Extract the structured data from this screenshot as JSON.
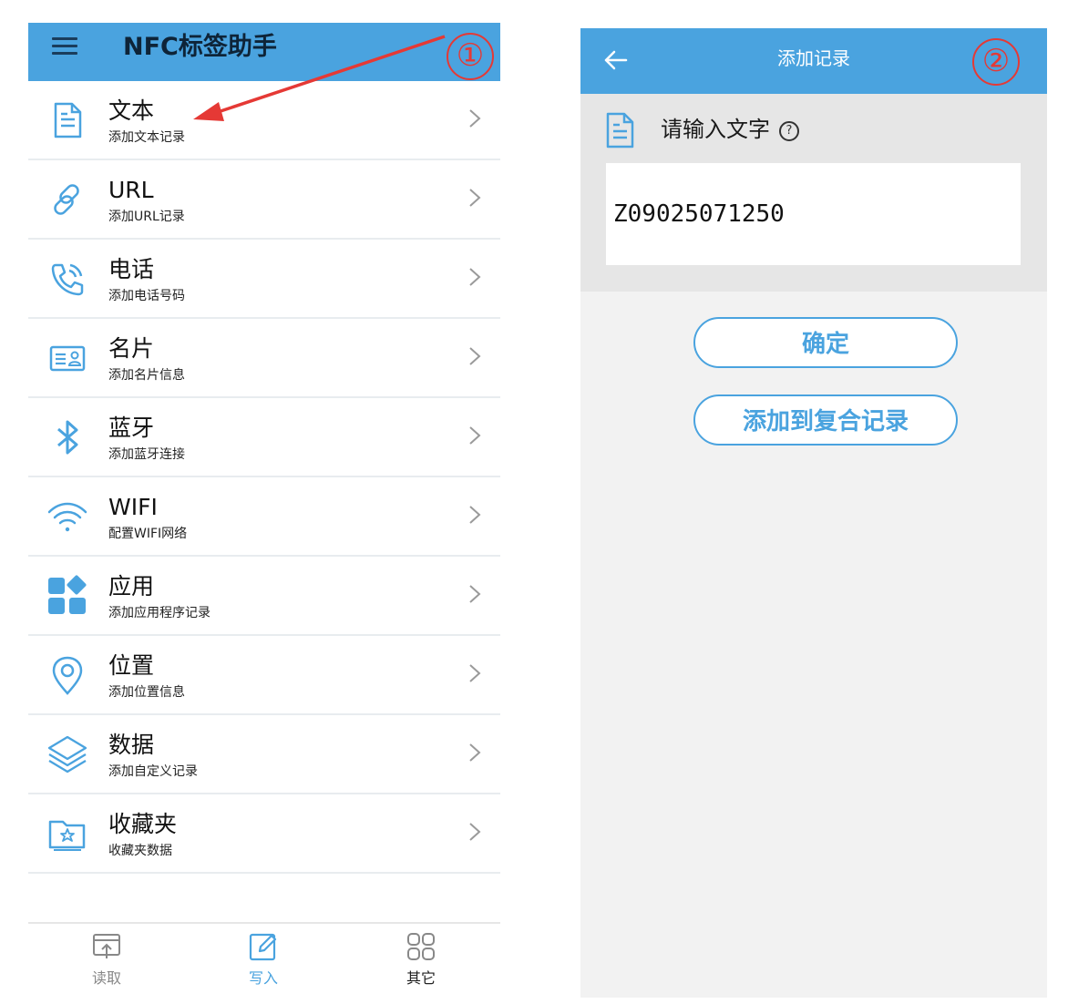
{
  "left": {
    "app_title": "NFC标签助手",
    "items": [
      {
        "title": "文本",
        "subtitle": "添加文本记录",
        "icon": "document-icon"
      },
      {
        "title": "URL",
        "subtitle": "添加URL记录",
        "icon": "link-icon"
      },
      {
        "title": "电话",
        "subtitle": "添加电话号码",
        "icon": "phone-icon"
      },
      {
        "title": "名片",
        "subtitle": "添加名片信息",
        "icon": "contact-card-icon"
      },
      {
        "title": "蓝牙",
        "subtitle": "添加蓝牙连接",
        "icon": "bluetooth-icon"
      },
      {
        "title": "WIFI",
        "subtitle": "配置WIFI网络",
        "icon": "wifi-icon"
      },
      {
        "title": "应用",
        "subtitle": "添加应用程序记录",
        "icon": "apps-icon"
      },
      {
        "title": "位置",
        "subtitle": "添加位置信息",
        "icon": "location-pin-icon"
      },
      {
        "title": "数据",
        "subtitle": "添加自定义记录",
        "icon": "layers-icon"
      },
      {
        "title": "收藏夹",
        "subtitle": "收藏夹数据",
        "icon": "favorites-folder-icon"
      }
    ],
    "tabs": [
      {
        "label": "读取",
        "icon": "read-icon"
      },
      {
        "label": "写入",
        "icon": "write-icon"
      },
      {
        "label": "其它",
        "icon": "grid-icon"
      }
    ],
    "annotation": "①"
  },
  "right": {
    "page_title": "添加记录",
    "prompt": "请输入文字",
    "help_symbol": "?",
    "input_value": "Z09025071250",
    "confirm_label": "确定",
    "add_composite_label": "添加到复合记录",
    "annotation": "②"
  },
  "colors": {
    "primary": "#4aa3df",
    "annotation_red": "#e53935"
  }
}
